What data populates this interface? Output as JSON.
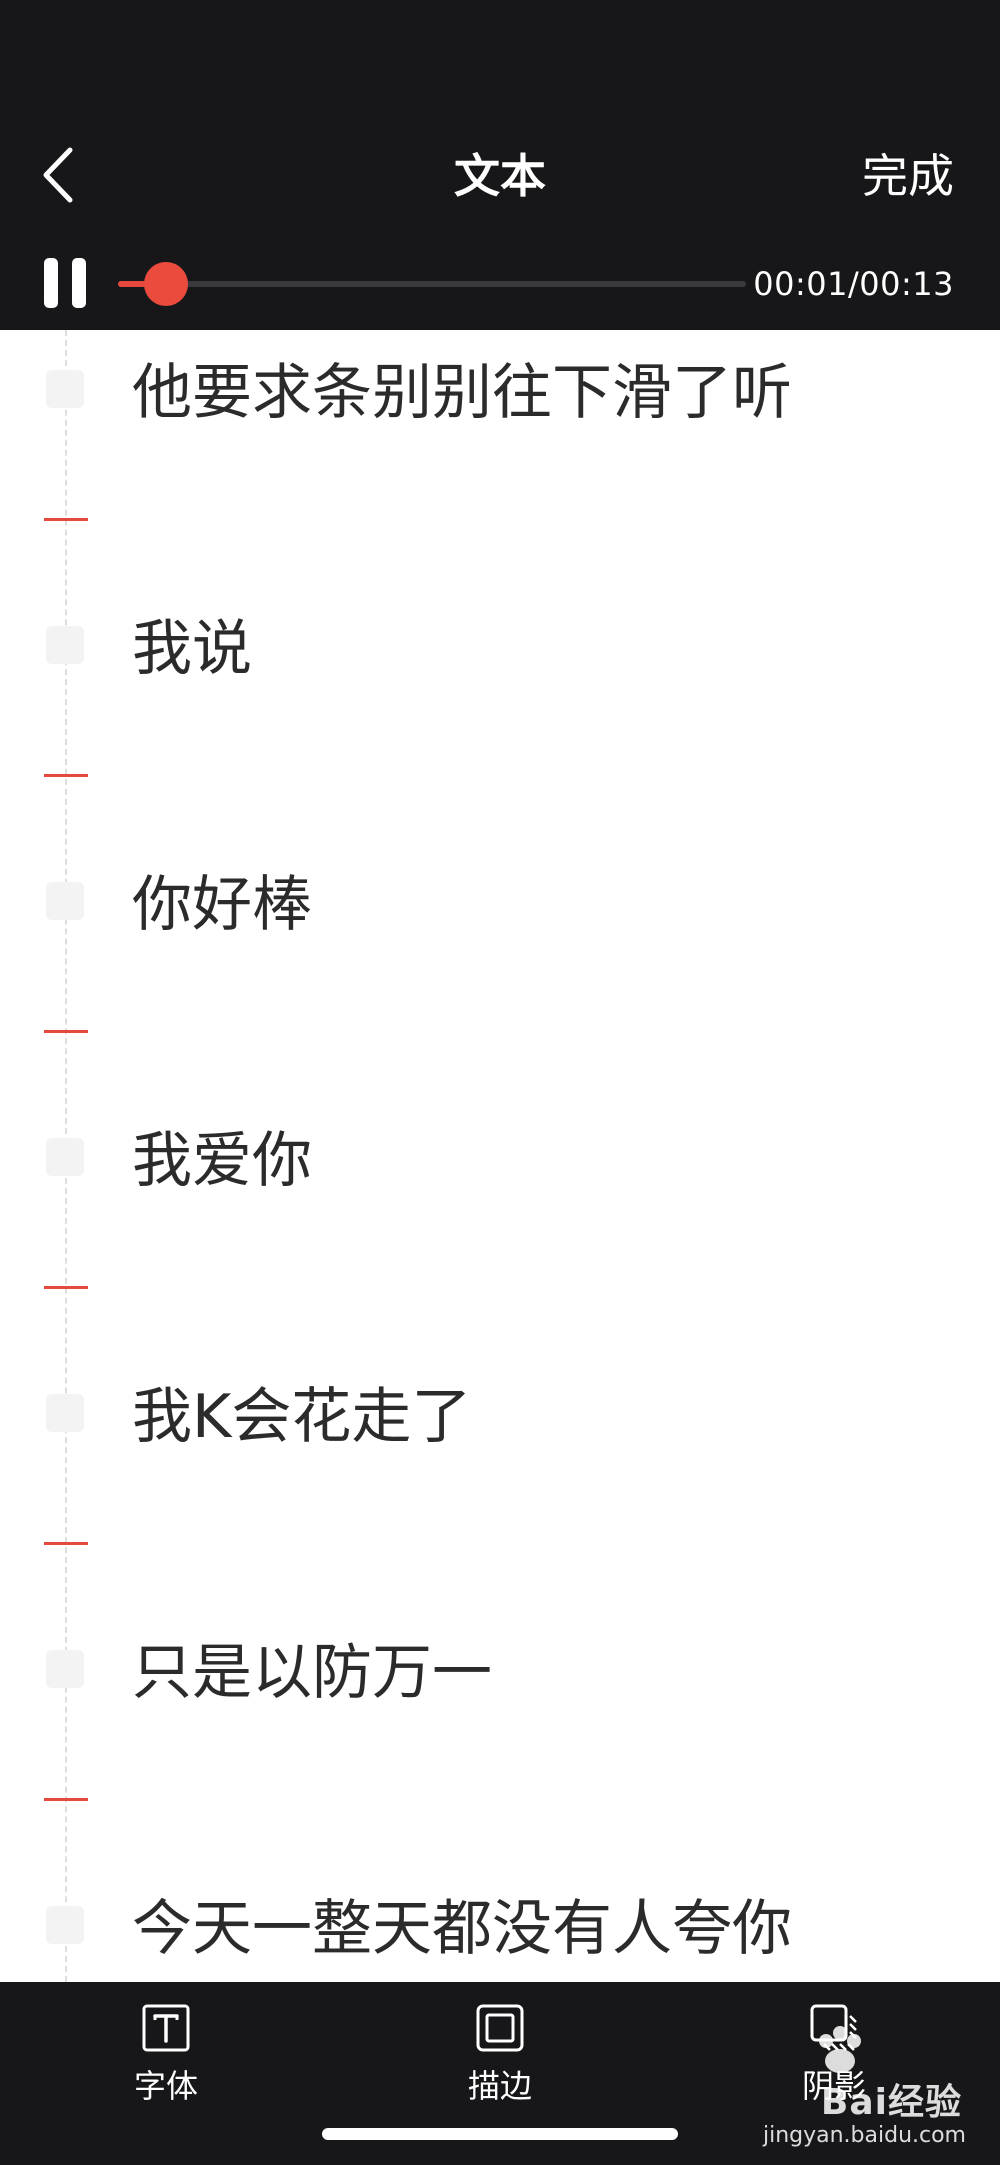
{
  "header": {
    "title": "文本",
    "done_label": "完成",
    "back_icon": "chevron-left-icon",
    "play_state_icon": "pause-icon",
    "time_readout": "00:01/00:13",
    "progress": 0.077,
    "accent_color": "#e5483c"
  },
  "lyrics": [
    {
      "text": "他要求条别别往下滑了听"
    },
    {
      "text": "我说"
    },
    {
      "text": "你好棒"
    },
    {
      "text": "我爱你"
    },
    {
      "text": "我K会花走了"
    },
    {
      "text": "只是以防万一"
    },
    {
      "text": "今天一整天都没有人夸你"
    }
  ],
  "toolbar": {
    "items": [
      {
        "label": "字体",
        "icon": "font-icon"
      },
      {
        "label": "描边",
        "icon": "stroke-icon"
      },
      {
        "label": "阴影",
        "icon": "shadow-icon"
      }
    ]
  },
  "watermark": {
    "brand": "Bai经验",
    "url": "jingyan.baidu.com"
  }
}
